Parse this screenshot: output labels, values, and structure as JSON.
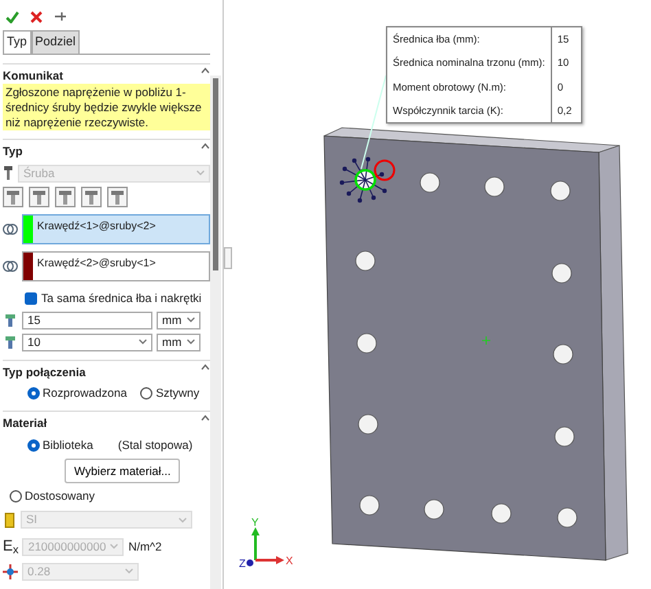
{
  "tabs": [
    {
      "label": "Typ",
      "selected": true
    },
    {
      "label": "Podziel",
      "selected": false
    }
  ],
  "message": {
    "title": "Komunikat",
    "text": "Zgłoszone naprężenie w pobliżu 1-średnicy śruby będzie zwykle większe niż naprężenie rzeczywiste."
  },
  "type": {
    "title": "Typ",
    "bolt_type": {
      "value": "Śruba",
      "disabled": true
    },
    "edges": [
      {
        "value": "Krawędź<1>@sruby<2>",
        "color": "#00ff00",
        "selected": true
      },
      {
        "value": "Krawędź<2>@sruby<1>",
        "color": "#800000",
        "selected": false
      }
    ],
    "same_diameter": {
      "label": "Ta sama średnica łba i nakrętki",
      "checked": true
    },
    "head_diameter": {
      "value": "15",
      "unit": "mm"
    },
    "shank_diameter": {
      "value": "10",
      "unit": "mm"
    }
  },
  "connection": {
    "title": "Typ połączenia",
    "options": [
      {
        "label": "Rozprowadzona",
        "selected": true
      },
      {
        "label": "Sztywny",
        "selected": false
      }
    ]
  },
  "material": {
    "title": "Materiał",
    "options": [
      {
        "label": "Biblioteka",
        "selected": true
      },
      {
        "label": "Dostosowany",
        "selected": false
      }
    ],
    "library_name": "(Stal stopowa)",
    "button": "Wybierz materiał...",
    "units": {
      "value": "SI",
      "disabled": true
    },
    "modulus": {
      "symbol": "E$_{x}$",
      "value": "210000000000",
      "unit": "N/m^2",
      "disabled": true
    },
    "poisson": {
      "value": "0.28",
      "disabled": true
    }
  },
  "table": {
    "rows": [
      {
        "label": "Średnica łba (mm):",
        "value": "15"
      },
      {
        "label": "Średnica nominalna trzonu (mm):",
        "value": "10"
      },
      {
        "label": "Moment obrotowy (N.m):",
        "value": "0"
      },
      {
        "label": "Współczynnik tarcia (K):",
        "value": "0,2"
      }
    ]
  },
  "axes": {
    "x": "X",
    "y": "Y",
    "z": "Z"
  }
}
